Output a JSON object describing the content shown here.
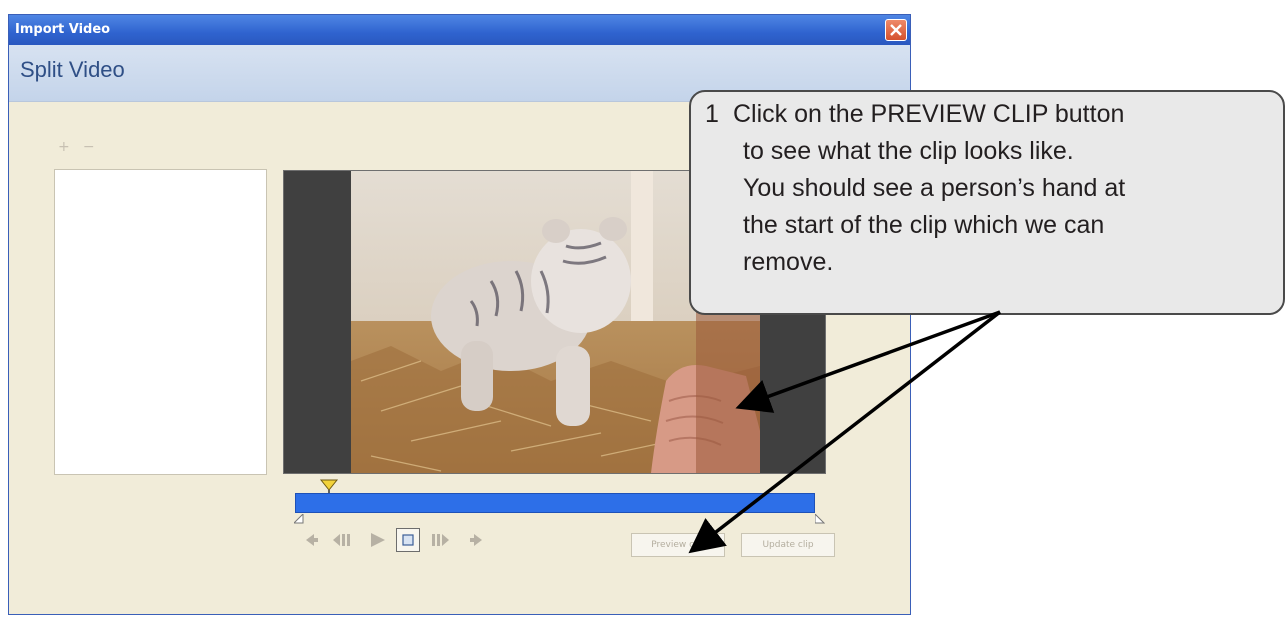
{
  "window": {
    "title": "Import Video",
    "heading": "Split Video",
    "close_icon": "close-icon"
  },
  "clip_list": {
    "add_symbol": "+",
    "remove_symbol": "−"
  },
  "timeline": {
    "position_fraction": 0.06
  },
  "controls": {
    "icons": [
      "go-to-start-icon",
      "step-back-icon",
      "play-icon",
      "stop-icon",
      "step-forward-icon",
      "go-to-end-icon"
    ]
  },
  "buttons": {
    "preview_clip": "Preview clip",
    "update_clip": "Update clip"
  },
  "callout": {
    "number": "1",
    "lines": [
      "Click on the PREVIEW CLIP button",
      "to see what the clip looks like.",
      "You should see a person’s hand at",
      "the start of the clip which we can",
      "remove."
    ]
  },
  "colors": {
    "titlebar": "#2f63cf",
    "header_band": "#c9d8ee",
    "dialog_bg": "#f1ecd9",
    "timeline": "#2d6fe8",
    "callout_bg": "#e9e9e9"
  }
}
